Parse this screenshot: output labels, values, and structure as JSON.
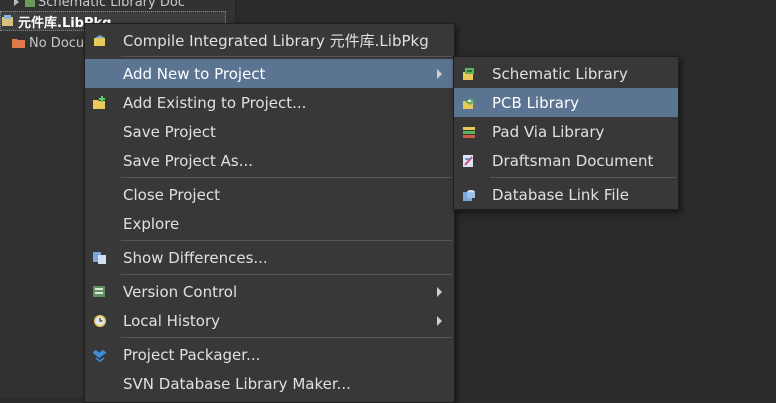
{
  "tree": {
    "row0_label": "Schematic Library Doc",
    "project_label": "元件库.LibPkg",
    "no_docs_label": "No Docu"
  },
  "main_menu": {
    "items": [
      {
        "label": "Compile Integrated Library 元件库.LibPkg",
        "icon": "compile-icon"
      },
      {
        "label": "Add New to Project",
        "icon": "",
        "submenu": true
      },
      {
        "label": "Add Existing to Project...",
        "icon": "add-existing-icon"
      },
      {
        "label": "Save Project",
        "icon": ""
      },
      {
        "label": "Save Project As...",
        "icon": ""
      },
      {
        "label": "Close Project",
        "icon": ""
      },
      {
        "label": "Explore",
        "icon": ""
      },
      {
        "label": "Show Differences...",
        "icon": "differences-icon"
      },
      {
        "label": "Version Control",
        "icon": "version-control-icon",
        "submenu": true
      },
      {
        "label": "Local History",
        "icon": "local-history-icon",
        "submenu": true
      },
      {
        "label": "Project Packager...",
        "icon": "packager-icon"
      },
      {
        "label": "SVN Database Library Maker...",
        "icon": ""
      }
    ]
  },
  "sub_menu": {
    "items": [
      {
        "label": "Schematic Library",
        "icon": "schematic-library-icon"
      },
      {
        "label": "PCB Library",
        "icon": "pcb-library-icon"
      },
      {
        "label": "Pad Via Library",
        "icon": "pad-via-library-icon"
      },
      {
        "label": "Draftsman Document",
        "icon": "draftsman-icon"
      },
      {
        "label": "Database Link File",
        "icon": "database-link-icon"
      }
    ]
  },
  "colors": {
    "highlight": "#5b7491",
    "menu_bg": "#383838",
    "panel_bg": "#323232"
  }
}
